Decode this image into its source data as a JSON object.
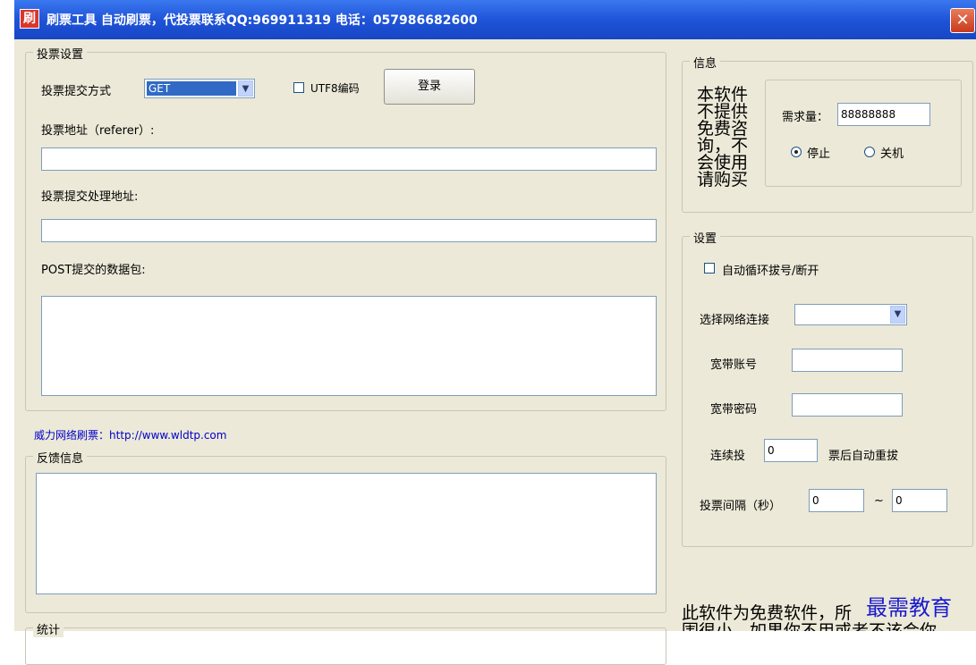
{
  "window": {
    "icon_char": "刷",
    "title": "刷票工具    自动刷票，代投票联系QQ:969911319  电话：057986682600",
    "close_symbol": "✕"
  },
  "vote_settings": {
    "legend": "投票设置",
    "method_label": "投票提交方式",
    "method_value": "GET",
    "utf8_label": "UTF8编码",
    "login_button": "登录",
    "referer_label": "投票地址（referer）:",
    "referer_value": "",
    "process_url_label": "投票提交处理地址:",
    "process_url_value": "",
    "post_label": "POST提交的数据包:",
    "post_value": ""
  },
  "site_link": {
    "label": "威力网络刷票：",
    "url": "http://www.wldtp.com"
  },
  "feedback": {
    "legend": "反馈信息",
    "value": ""
  },
  "stats": {
    "legend": "统计"
  },
  "info": {
    "legend": "信息",
    "notice_lines": [
      "本软件",
      "不提供",
      "免费咨",
      "询，不",
      "会使用",
      "请购买"
    ],
    "demand_label": "需求量：",
    "demand_value": "88888888",
    "radio_stop": "停止",
    "radio_shutdown": "关机"
  },
  "settings": {
    "legend": "设置",
    "auto_dial_label": "自动循环拔号/断开",
    "network_label": "选择网络连接",
    "network_value": "",
    "account_label": "宽带账号",
    "account_value": "",
    "password_label": "宽带密码",
    "password_value": "",
    "continuous_label": "连续投",
    "continuous_value": "0",
    "redial_label": "票后自动重拔",
    "interval_label": "投票间隔（秒）",
    "interval_from": "0",
    "interval_tilde": "~",
    "interval_to": "0"
  },
  "footer_text": {
    "line1": "此软件为免费软件，所",
    "line2": "围很小，如果你不用或者不该会你"
  },
  "watermark": "最需教育"
}
